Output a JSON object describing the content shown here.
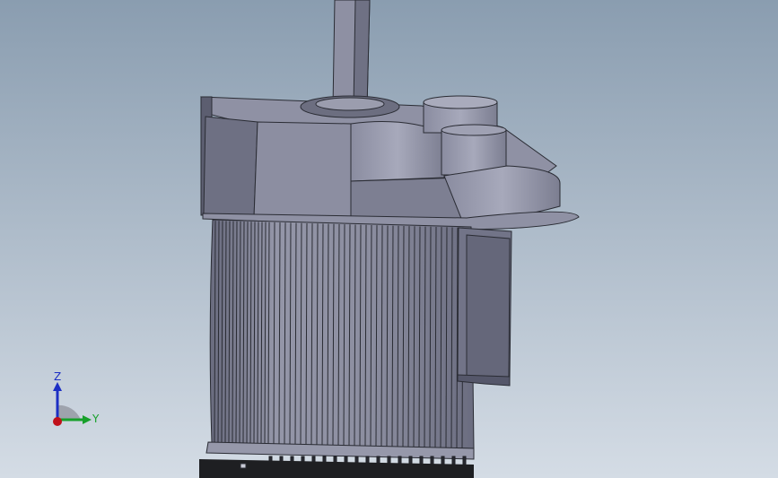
{
  "viewport": {
    "background_top": "#8a9db0",
    "background_bottom": "#d4dce5"
  },
  "model": {
    "body_color": "#7f8194",
    "face_light": "#9a9cae",
    "face_dark": "#5f6174",
    "edge_color": "#2a2c34",
    "base_color": "#1e1f22"
  },
  "triad": {
    "z_label": "Z",
    "y_label": "Y",
    "x_color": "#c0101a",
    "y_color": "#17a02b",
    "z_color": "#1c2fc4"
  }
}
